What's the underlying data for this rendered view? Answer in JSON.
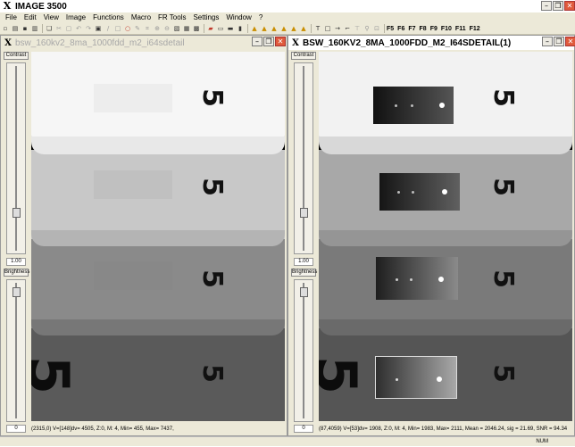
{
  "app": {
    "title": "IMAGE 3500",
    "logo": "X"
  },
  "menu": [
    "File",
    "Edit",
    "View",
    "Image",
    "Functions",
    "Macro",
    "FR Tools",
    "Settings",
    "Window",
    "?"
  ],
  "toolbar": {
    "func_keys": [
      "F5",
      "F6",
      "F7",
      "F8",
      "F9",
      "F10",
      "F11",
      "F12"
    ]
  },
  "left_window": {
    "title": "bsw_160kv2_8ma_1000fdd_m2_i64sdetail",
    "contrast_label": "Contrast",
    "contrast_value": "1.00",
    "brightness_label": "Brightness",
    "brightness_value": "0",
    "status": "(2315,0) V=[148]dv= 4505, Z:0, M: 4, Min=  455, Max= 7437,"
  },
  "right_window": {
    "title": "BSW_160KV2_8MA_1000FDD_M2_I64SDETAIL(1)",
    "contrast_label": "Contrast",
    "contrast_value": "1.00",
    "brightness_label": "Brightness",
    "brightness_value": "0",
    "status": "(87,4059) V=[53]dv= 1908, Z:0, M: 4, Min= 1983, Max= 2111, Mean = 2046.24, sig = 21.69, SNR = 94.34"
  },
  "image_text": {
    "digit": "5"
  },
  "statusbar": {
    "num": "NUM"
  }
}
